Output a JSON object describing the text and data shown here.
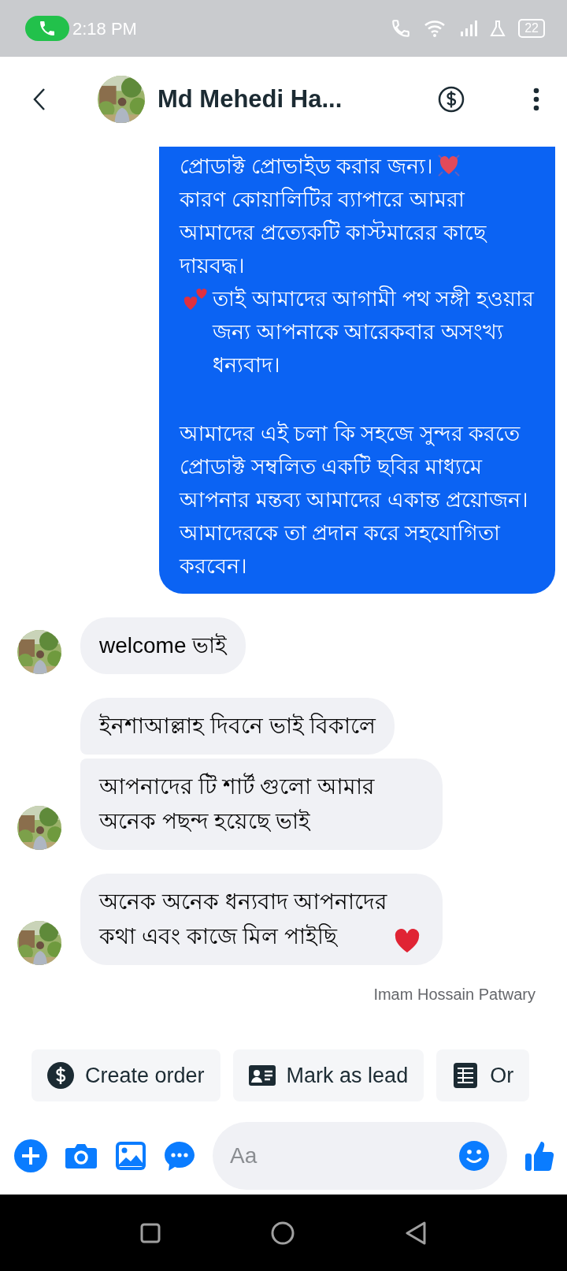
{
  "status_bar": {
    "time": "2:18 PM",
    "battery": "22"
  },
  "header": {
    "name": "Md Mehedi Ha..."
  },
  "messages": [
    {
      "kind": "sent",
      "parts": [
        {
          "kind": "text",
          "text": "প্রোডাক্ট প্রোভাইড করার জন্য।"
        },
        {
          "kind": "sparkle-heart"
        },
        {
          "kind": "break"
        },
        {
          "kind": "text",
          "text": "কারণ কোয়ালিটির ব্যাপারে আমরা আমাদের প্রত্যেকটি কাস্টমারের কাছে দায়বদ্ধ।"
        },
        {
          "kind": "break"
        },
        {
          "kind": "two-hearts"
        },
        {
          "kind": "text",
          "text": "তাই আমাদের আগামী পথ সঙ্গী হওয়ার জন্য আপনাকে আরেকবার অসংখ্য ধন্যবাদ।"
        },
        {
          "kind": "gap"
        },
        {
          "kind": "text",
          "text": "আমাদের এই চলা কি সহজে সুন্দর করতে প্রোডাক্ট সম্বলিত একটি ছবির মাধ্যমে আপনার মন্তব্য আমাদের একান্ত প্রয়োজন। আমাদেরকে তা প্রদান করে সহযোগিতা করবেন।"
        }
      ]
    },
    {
      "kind": "received",
      "new_group": true,
      "avatar": true,
      "parts": [
        {
          "kind": "text",
          "text": "welcome ভাই"
        }
      ]
    },
    {
      "kind": "received",
      "new_group": true,
      "avatar": false,
      "parts": [
        {
          "kind": "text",
          "text": "ইনশাআল্লাহ দিবনে ভাই বিকালে"
        }
      ]
    },
    {
      "kind": "received",
      "new_group": false,
      "avatar": true,
      "parts": [
        {
          "kind": "text",
          "text": "আপনাদের টি শার্ট গুলো আমার অনেক পছন্দ হয়েছে ভাই"
        }
      ]
    },
    {
      "kind": "received",
      "new_group": true,
      "avatar": true,
      "parts": [
        {
          "kind": "text",
          "text": "অনেক অনেক ধন্যবাদ আপনাদের কথা এবং কাজে মিল পাইছি"
        },
        {
          "kind": "heart"
        }
      ]
    }
  ],
  "seen_by": "Imam Hossain Patwary",
  "quick_replies": [
    {
      "kind": "dollar",
      "label": "Create order"
    },
    {
      "kind": "contact",
      "label": "Mark as lead"
    },
    {
      "kind": "list",
      "label": "Or"
    }
  ],
  "composer": {
    "placeholder": "Aa"
  }
}
